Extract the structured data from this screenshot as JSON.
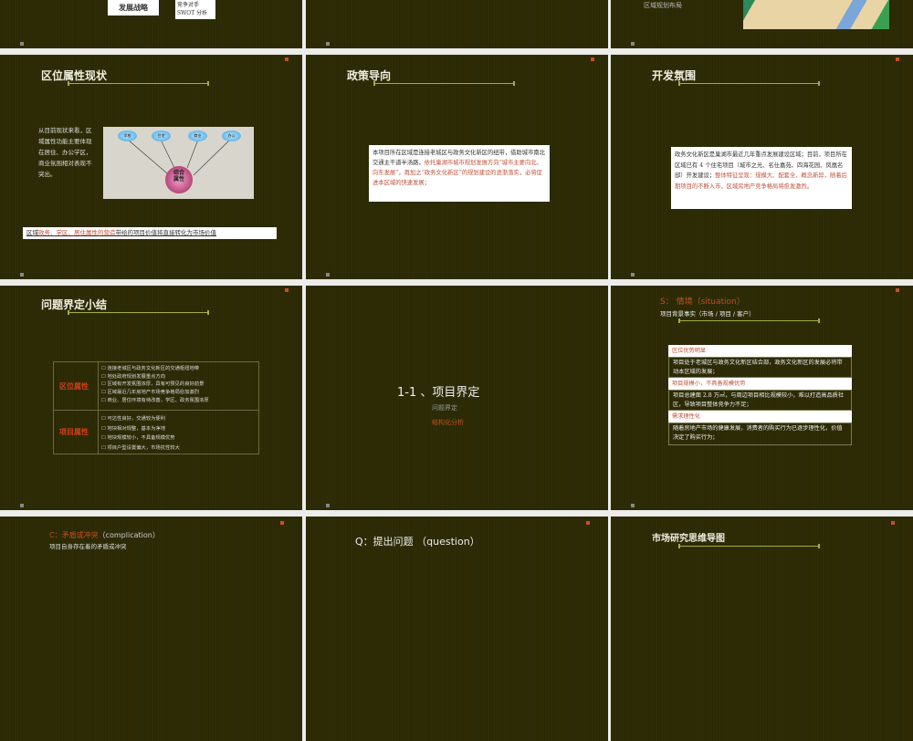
{
  "slides": [
    {
      "id": "top-left",
      "box_label": "发展战略",
      "items": [
        "竞争对手",
        "SWOT 分析"
      ]
    },
    {
      "id": "top-right",
      "text": "区域规划布局"
    },
    {
      "id": "location",
      "title": "区位属性现状",
      "description": "从目前现状来看，区域属性功能主要体现在居住、办公学区，商业氛围相对表现不突出。",
      "nodes": [
        "学校",
        "住宅",
        "商业",
        "办公"
      ],
      "center": "综合属性",
      "banner_a": "区域",
      "banner_b": "政务、学区、居住属性的营造",
      "banner_c": "带给的项目价值将直接转化为市场价值"
    },
    {
      "id": "policy",
      "title": "政策导向",
      "text_a": "本项目所在区域是连接老城区与政务文化新区的纽带，借助城市南北交通主干道半汤路，",
      "text_b": "依托巢湖市城市规划发展方向“城市主要向北、向东发展”，再加之“政务文化新区”的规划建设的逐渐落实，必将促进本区域的快速发展；"
    },
    {
      "id": "development",
      "title": "开发氛围",
      "text_a": "政务文化新区是巢湖市最近几年重点发展建设区域；目前，项目所在区域已有 4 个住宅项目（城市之光、名仕嘉苑、四海花园、凤凰名邸）开发建设；",
      "text_b": "整体特征呈现：规模大、配套全、概念新异，随着后期项目的不断入市，区域房地产竞争格局将愈发激烈。"
    },
    {
      "id": "summary",
      "title": "问题界定小结",
      "groups": [
        {
          "label": "区位属性",
          "items": [
            "连接老城区与政务文化新区的交通枢纽地带",
            "地处政府规划发展重点方向",
            "区域有开发氛围浓厚，具有可预见的良好前景",
            "区域最近几年房地产市场竞争格局愈加激烈",
            "商业、居住环境有待改善，学区、政务氛围浓厚"
          ]
        },
        {
          "label": "项目属性",
          "items": [
            "可达性良好，交通较为便利",
            "地块相对规整，基本为净地",
            "地块规模较小，不具备规模优势",
            "项目户型设置偏大，市场抗性较大"
          ]
        }
      ]
    },
    {
      "id": "section",
      "title": "1-1 、项目界定",
      "sub1": "问题界定",
      "sub2": "结构化分析"
    },
    {
      "id": "situation",
      "title": "S： 情境（situation）",
      "subtitle": "项目背景事实（市场 / 项目 / 客户）",
      "blocks": [
        {
          "head": "区位优势明显",
          "body": "项目处于老城区与政务文化新区结合部，政务文化新区的发展必将带动本区域的发展；"
        },
        {
          "head": "项目规模小，不具备规模优势",
          "body": "项目总建面 2.8 万㎡，与周边项目相比规模较小，难以打造高品质社区，导致项目整体竞争力不足；"
        },
        {
          "head": "需求理性化",
          "body": "随着房地产市场的健康发展，消费者的购买行为已逐步理性化，价值决定了购买行为；"
        }
      ]
    },
    {
      "id": "complication",
      "title_a": "C：矛盾或冲突",
      "title_b": "（complication）",
      "subtitle": "项目自身存在着的矛盾或冲突"
    },
    {
      "id": "question",
      "title": "Q：提出问题 （question）"
    },
    {
      "id": "mindmap",
      "title": "市场研究思维导图"
    }
  ]
}
